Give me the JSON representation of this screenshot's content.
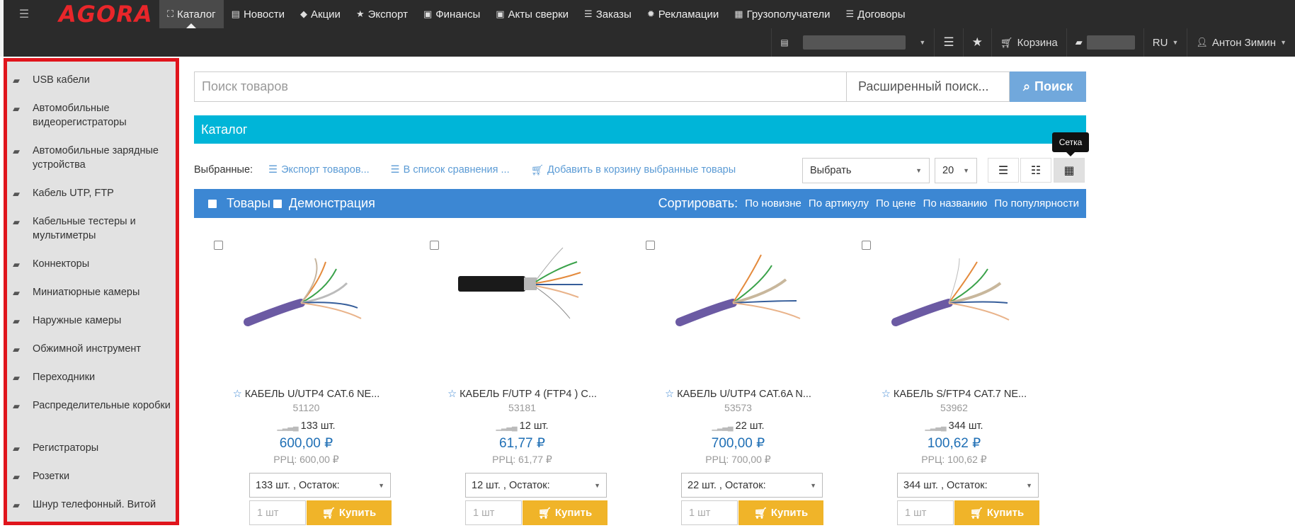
{
  "topbar": {
    "logo": "AGORA",
    "nav": [
      {
        "label": "Каталог",
        "icon": "sitemap-icon",
        "glyph": "⛶",
        "active": true
      },
      {
        "label": "Новости",
        "icon": "file-icon",
        "glyph": "🗎",
        "active": false
      },
      {
        "label": "Акции",
        "icon": "tag-icon",
        "glyph": "🏷",
        "active": false
      },
      {
        "label": "Экспорт",
        "icon": "star-icon",
        "glyph": "★",
        "active": false
      },
      {
        "label": "Финансы",
        "icon": "money-icon",
        "glyph": "▣",
        "active": false
      },
      {
        "label": "Акты сверки",
        "icon": "money-icon",
        "glyph": "▣",
        "active": false
      },
      {
        "label": "Заказы",
        "icon": "list-icon",
        "glyph": "☰",
        "active": false
      },
      {
        "label": "Рекламации",
        "icon": "gear-icon",
        "glyph": "✹",
        "active": false
      },
      {
        "label": "Грузополучатели",
        "icon": "calendar-icon",
        "glyph": "▦",
        "active": false
      },
      {
        "label": "Договоры",
        "icon": "list-icon",
        "glyph": "☰",
        "active": false
      }
    ],
    "row2": {
      "cart_label": "Корзина",
      "lang": "RU",
      "user": "Антон Зимин"
    }
  },
  "sidebar": {
    "items": [
      {
        "label": "USB кабели"
      },
      {
        "label": "Автомобильные видеорегистраторы"
      },
      {
        "label": "Автомобильные зарядные устройства"
      },
      {
        "label": "Кабель UTP, FTP"
      },
      {
        "label": "Кабельные тестеры и мультиметры"
      },
      {
        "label": "Коннекторы"
      },
      {
        "label": "Миниатюрные камеры"
      },
      {
        "label": "Наружные камеры"
      },
      {
        "label": "Обжимной инструмент"
      },
      {
        "label": "Переходники"
      },
      {
        "label": "Распределительные коробки"
      },
      {
        "label": "Регистраторы"
      },
      {
        "label": "Розетки"
      },
      {
        "label": "Шнур телефонный. Витой"
      }
    ]
  },
  "search": {
    "placeholder": "Поиск товаров",
    "advanced": "Расширенный поиск...",
    "button": "Поиск"
  },
  "catalog": {
    "title": "Каталог",
    "tooltip": "Сетка"
  },
  "selection": {
    "label": "Выбранные:",
    "links": [
      "Экспорт товаров...",
      "В список сравнения ...",
      "Добавить в корзину выбранные товары"
    ],
    "select_value": "Выбрать",
    "page_size": "20"
  },
  "sortbar": {
    "tab1": "Товары",
    "tab2": "Демонстрация",
    "sort_title": "Сортировать:",
    "options": [
      "По новизне",
      "По артикулу",
      "По цене",
      "По названию",
      "По популярности"
    ]
  },
  "products": [
    {
      "title": "КАБЕЛЬ U/UTP4 CAT.6 NE...",
      "code": "51120",
      "qty": "133 шт.",
      "price": "600,00 ₽",
      "rrc": "РРЦ: 600,00 ₽",
      "select": "133 шт. , Остаток:",
      "buy_qty": "1 шт",
      "buy": "Купить"
    },
    {
      "title": "КАБЕЛЬ F/UTP 4 (FTP4 ) C...",
      "code": "53181",
      "qty": "12 шт.",
      "price": "61,77 ₽",
      "rrc": "РРЦ: 61,77 ₽",
      "select": "12 шт. , Остаток:",
      "buy_qty": "1 шт",
      "buy": "Купить"
    },
    {
      "title": "КАБЕЛЬ U/UTP4 CAT.6A N...",
      "code": "53573",
      "qty": "22 шт.",
      "price": "700,00 ₽",
      "rrc": "РРЦ: 700,00 ₽",
      "select": "22 шт. , Остаток:",
      "buy_qty": "1 шт",
      "buy": "Купить"
    },
    {
      "title": "КАБЕЛЬ S/FTP4 CAT.7 NE...",
      "code": "53962",
      "qty": "344 шт.",
      "price": "100,62 ₽",
      "rrc": "РРЦ: 100,62 ₽",
      "select": "344 шт. , Остаток:",
      "buy_qty": "1 шт",
      "buy": "Купить"
    }
  ]
}
